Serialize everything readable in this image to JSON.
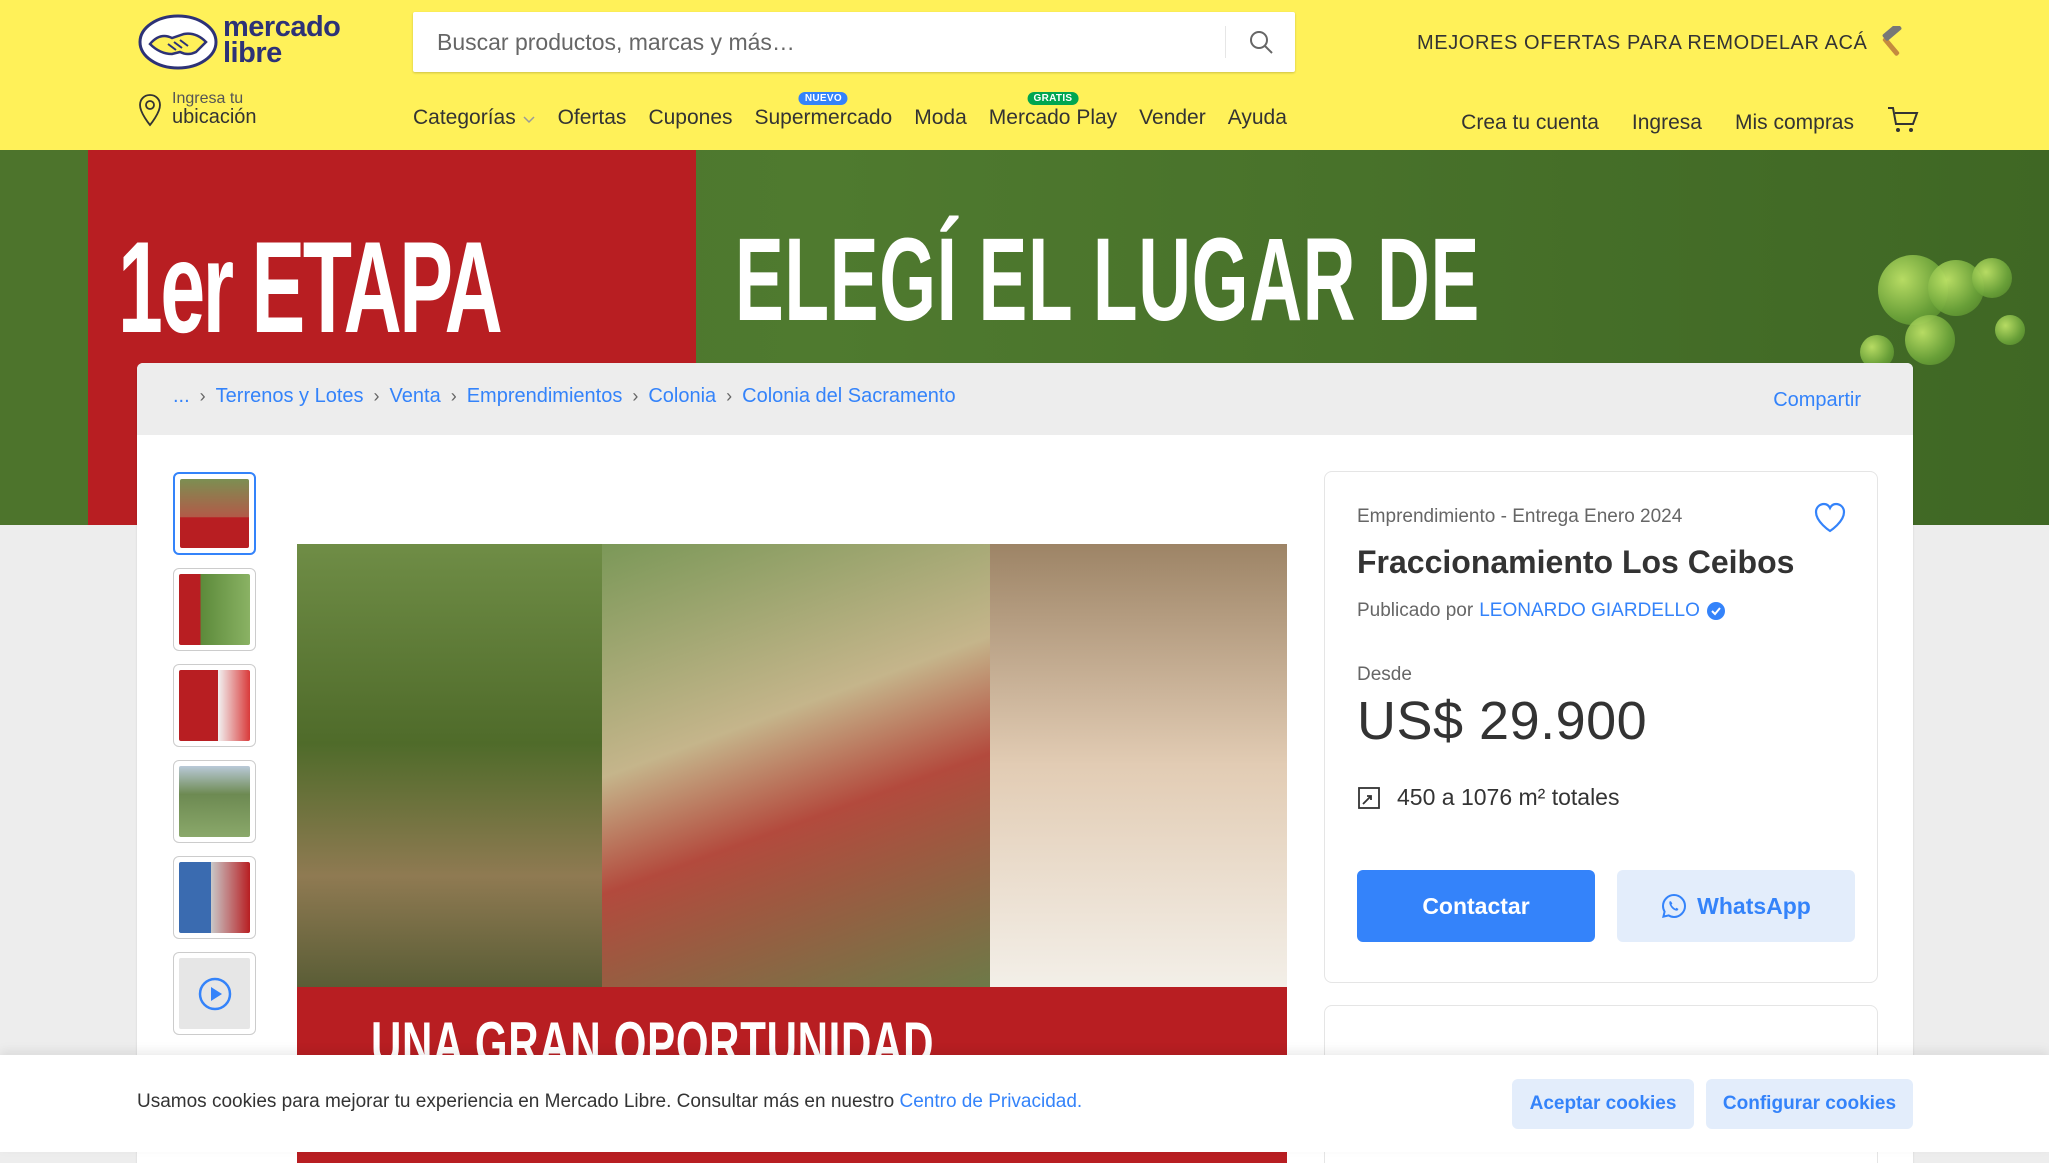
{
  "header": {
    "logo": "mercado libre",
    "logo_line1": "mercado",
    "logo_line2": "libre",
    "search_placeholder": "Buscar productos, marcas y más…",
    "promo": "MEJORES OFERTAS PARA REMODELAR ACÁ",
    "location_line1": "Ingresa tu",
    "location_line2": "ubicación",
    "nav": [
      {
        "label": "Categorías"
      },
      {
        "label": "Ofertas"
      },
      {
        "label": "Cupones"
      },
      {
        "label": "Supermercado",
        "badge": "NUEVO"
      },
      {
        "label": "Moda"
      },
      {
        "label": "Mercado Play",
        "badge": "GRATIS"
      },
      {
        "label": "Vender"
      },
      {
        "label": "Ayuda"
      }
    ],
    "account": [
      "Crea tu cuenta",
      "Ingresa",
      "Mis compras"
    ],
    "colors": {
      "brand_yellow": "#fff159",
      "brand_blue": "#2d3277",
      "link": "#3483fa",
      "badge_new": "#3483fa",
      "badge_free": "#00a650"
    }
  },
  "banner": {
    "left_text": "1er ETAPA",
    "right_text": "ELEGÍ EL LUGAR DE"
  },
  "breadcrumb": {
    "items": [
      "...",
      "Terrenos y Lotes",
      "Venta",
      "Emprendimientos",
      "Colonia",
      "Colonia del Sacramento"
    ],
    "share": "Compartir"
  },
  "gallery": {
    "thumb_count": 6,
    "main_caption": "UNA GRAN OPORTUNIDAD"
  },
  "listing": {
    "subtitle": "Emprendimiento - Entrega Enero 2024",
    "title": "Fraccionamiento Los Ceibos",
    "published_by_label": "Publicado por",
    "seller": "LEONARDO GIARDELLO",
    "price_label": "Desde",
    "price": "US$ 29.900",
    "area": "450 a 1076 m² totales",
    "contact_button": "Contactar",
    "whatsapp_button": "WhatsApp"
  },
  "cookie": {
    "text": "Usamos cookies para mejorar tu experiencia en Mercado Libre. Consultar más en nuestro ",
    "link": "Centro de Privacidad.",
    "accept": "Aceptar cookies",
    "configure": "Configurar cookies"
  }
}
